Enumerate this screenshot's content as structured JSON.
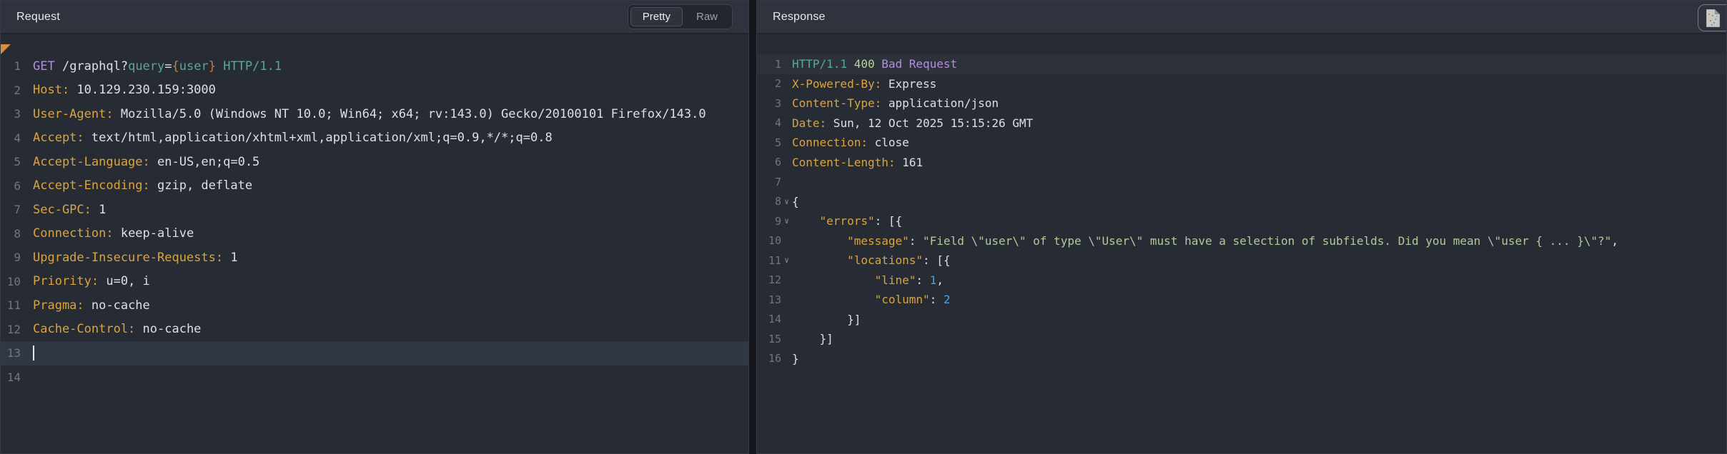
{
  "colors": {
    "editor_bg": "#272b33",
    "header_bg": "#2e333d",
    "header_key_orange": "#d9a440",
    "method_purple": "#b48ede",
    "teal": "#57ab8e",
    "status_green": "#bcd3a2",
    "string_green": "#b2c99c",
    "number_blue": "#559fd6",
    "url_brace_orange": "#c07f45",
    "line_number_gray": "#6f7681",
    "edited_marker_orange": "#d98f3a",
    "current_line_bg": "#313845"
  },
  "request_panel": {
    "title": "Request",
    "tabs": [
      {
        "label": "Pretty",
        "active": true
      },
      {
        "label": "Raw",
        "active": false
      }
    ],
    "lines": [
      {
        "n": 1,
        "seg": [
          [
            "method",
            "GET"
          ],
          [
            "plain",
            " /graphql?"
          ],
          [
            "param",
            "query"
          ],
          [
            "plain",
            "="
          ],
          [
            "brace",
            "{"
          ],
          [
            "param",
            "user"
          ],
          [
            "brace",
            "}"
          ],
          [
            "ver",
            " HTTP/1.1"
          ]
        ]
      },
      {
        "n": 2,
        "seg": [
          [
            "key",
            "Host:"
          ],
          [
            "plain",
            " 10.129.230.159:3000"
          ]
        ]
      },
      {
        "n": 3,
        "seg": [
          [
            "key",
            "User-Agent:"
          ],
          [
            "plain",
            " Mozilla/5.0 (Windows NT 10.0; Win64; x64; rv:143.0) Gecko/20100101 Firefox/143.0"
          ]
        ]
      },
      {
        "n": 4,
        "seg": [
          [
            "key",
            "Accept:"
          ],
          [
            "plain",
            " text/html,application/xhtml+xml,application/xml;q=0.9,*/*;q=0.8"
          ]
        ]
      },
      {
        "n": 5,
        "seg": [
          [
            "key",
            "Accept-Language:"
          ],
          [
            "plain",
            " en-US,en;q=0.5"
          ]
        ]
      },
      {
        "n": 6,
        "seg": [
          [
            "key",
            "Accept-Encoding:"
          ],
          [
            "plain",
            " gzip, deflate"
          ]
        ]
      },
      {
        "n": 7,
        "seg": [
          [
            "key",
            "Sec-GPC:"
          ],
          [
            "plain",
            " 1"
          ]
        ]
      },
      {
        "n": 8,
        "seg": [
          [
            "key",
            "Connection:"
          ],
          [
            "plain",
            " keep-alive"
          ]
        ]
      },
      {
        "n": 9,
        "seg": [
          [
            "key",
            "Upgrade-Insecure-Requests:"
          ],
          [
            "plain",
            " 1"
          ]
        ]
      },
      {
        "n": 10,
        "seg": [
          [
            "key",
            "Priority:"
          ],
          [
            "plain",
            " u=0, i"
          ]
        ]
      },
      {
        "n": 11,
        "seg": [
          [
            "key",
            "Pragma:"
          ],
          [
            "plain",
            " no-cache"
          ]
        ]
      },
      {
        "n": 12,
        "seg": [
          [
            "key",
            "Cache-Control:"
          ],
          [
            "plain",
            " no-cache"
          ]
        ]
      },
      {
        "n": 13,
        "seg": [],
        "hl": "current",
        "caret": true
      },
      {
        "n": 14,
        "seg": []
      }
    ]
  },
  "response_panel": {
    "title": "Response",
    "status_summary": "HTTP/1.1 400 Bad Request",
    "lines": [
      {
        "n": 1,
        "seg": [
          [
            "ver",
            "HTTP/1.1"
          ],
          [
            "status",
            " 400"
          ],
          [
            "reason",
            " Bad Request"
          ]
        ],
        "hl": "soft"
      },
      {
        "n": 2,
        "seg": [
          [
            "key",
            "X-Powered-By:"
          ],
          [
            "plain",
            " Express"
          ]
        ]
      },
      {
        "n": 3,
        "seg": [
          [
            "key",
            "Content-Type:"
          ],
          [
            "plain",
            " application/json"
          ]
        ]
      },
      {
        "n": 4,
        "seg": [
          [
            "key",
            "Date:"
          ],
          [
            "plain",
            " Sun, 12 Oct 2025 15:15:26 GMT"
          ]
        ]
      },
      {
        "n": 5,
        "seg": [
          [
            "key",
            "Connection:"
          ],
          [
            "plain",
            " close"
          ]
        ]
      },
      {
        "n": 6,
        "seg": [
          [
            "key",
            "Content-Length:"
          ],
          [
            "plain",
            " 161"
          ]
        ]
      },
      {
        "n": 7,
        "seg": []
      },
      {
        "n": 8,
        "fold": true,
        "seg": [
          [
            "plain",
            "{"
          ]
        ]
      },
      {
        "n": 9,
        "fold": true,
        "seg": [
          [
            "plain",
            "    "
          ],
          [
            "key",
            "\"errors\""
          ],
          [
            "plain",
            ": [{"
          ]
        ]
      },
      {
        "n": 10,
        "seg": [
          [
            "plain",
            "        "
          ],
          [
            "key",
            "\"message\""
          ],
          [
            "plain",
            ": "
          ],
          [
            "str",
            "\"Field \\\"user\\\" of type \\\"User\\\" must have a selection of subfields. Did you mean \\\"user { ... }\\\"?\""
          ],
          [
            "plain",
            ","
          ]
        ]
      },
      {
        "n": 11,
        "fold": true,
        "seg": [
          [
            "plain",
            "        "
          ],
          [
            "key",
            "\"locations\""
          ],
          [
            "plain",
            ": [{"
          ]
        ]
      },
      {
        "n": 12,
        "seg": [
          [
            "plain",
            "            "
          ],
          [
            "key",
            "\"line\""
          ],
          [
            "plain",
            ": "
          ],
          [
            "num",
            "1"
          ],
          [
            "plain",
            ","
          ]
        ]
      },
      {
        "n": 13,
        "seg": [
          [
            "plain",
            "            "
          ],
          [
            "key",
            "\"column\""
          ],
          [
            "plain",
            ": "
          ],
          [
            "num",
            "2"
          ]
        ]
      },
      {
        "n": 14,
        "seg": [
          [
            "plain",
            "        }]"
          ]
        ]
      },
      {
        "n": 15,
        "seg": [
          [
            "plain",
            "    }]"
          ]
        ]
      },
      {
        "n": 16,
        "seg": [
          [
            "plain",
            "}"
          ]
        ]
      }
    ]
  }
}
